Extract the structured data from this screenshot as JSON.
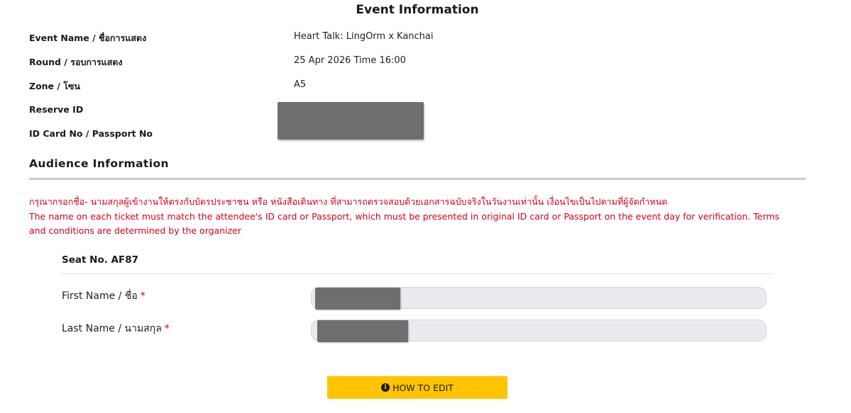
{
  "event_info": {
    "title": "Event Information",
    "rows": [
      {
        "label": "Event Name / ชื่อการแสดง",
        "value": "Heart Talk: LingOrm x Kanchai"
      },
      {
        "label": "Round / รอบการแสดง",
        "value": "25 Apr 2026 Time 16:00"
      },
      {
        "label": "Zone / โซน",
        "value": "A5"
      },
      {
        "label": "Reserve ID",
        "value": ""
      },
      {
        "label": "ID Card No / Passport No",
        "value": ""
      }
    ]
  },
  "audience": {
    "title": "Audience Information",
    "notice_th": "กรุณากรอกชื่อ- นามสกุลผู้เข้างานให้ตรงกับบัตรประชาชน หรือ หนังสือเดินทาง ที่สามารถตรวจสอบด้วยเอกสารฉบับจริงในวันงานเท่านั้น เงื่อนไขเป็นไปตามที่ผู้จัดกำหนด",
    "notice_en": "The name on each ticket must match the attendee's ID card or Passport, which must be presented in original ID card or Passport on the event day for verification. Terms and conditions are determined by the organizer",
    "notice_color": "#d0021b"
  },
  "seat": {
    "title": "Seat No. AF87",
    "first_name_label": "First Name / ชื่อ",
    "last_name_label": "Last Name / นามสกุล",
    "required_mark": "*"
  },
  "actions": {
    "how_to_edit_label": "HOW TO EDIT",
    "how_to_edit_icon": "info-circle-icon",
    "button_color": "#ffc400"
  }
}
